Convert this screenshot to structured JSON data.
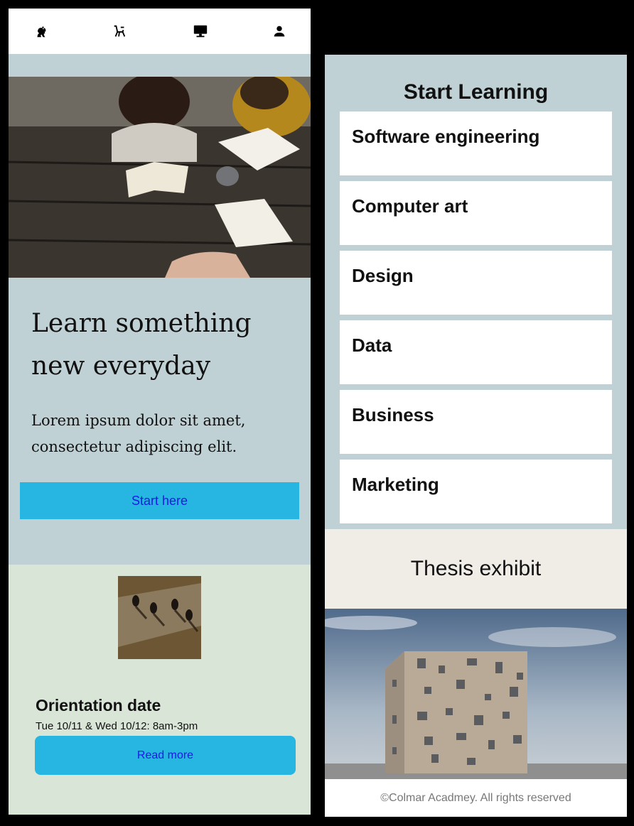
{
  "nav": {
    "icons": [
      "lion-icon",
      "chair-icon",
      "desktop-icon",
      "person-icon"
    ]
  },
  "hero": {
    "title": "Learn something new everyday",
    "subtitle": "Lorem ipsum dolor sit amet, consectetur adipiscing elit.",
    "cta_label": "Start here"
  },
  "event": {
    "title": "Orientation date",
    "date": "Tue 10/11 & Wed 10/12: 8am-3pm",
    "button_label": "Read more"
  },
  "learning": {
    "title": "Start Learning",
    "courses": [
      "Software engineering",
      "Computer art",
      "Design",
      "Data",
      "Business",
      "Marketing"
    ]
  },
  "thesis": {
    "title": "Thesis exhibit"
  },
  "footer": {
    "text": "©Colmar Acadmey. All rights reserved"
  },
  "colors": {
    "panel_bg": "#c0d1d6",
    "event_bg": "#d9e6d7",
    "thesis_bg": "#f0ece6",
    "accent": "#27b5e1",
    "link_text": "#1a1ae6"
  }
}
